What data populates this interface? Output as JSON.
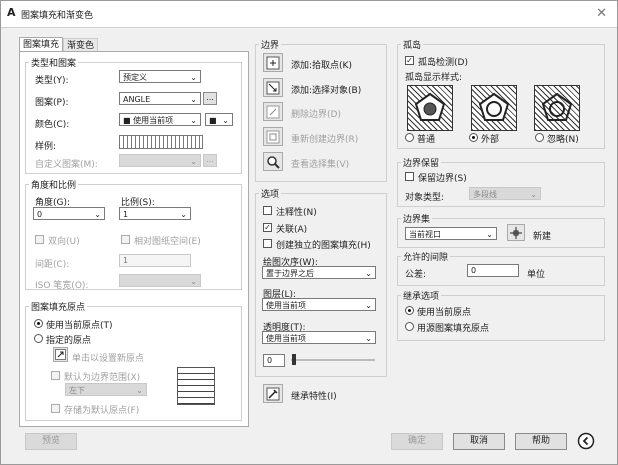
{
  "window": {
    "title": "图案填充和渐变色"
  },
  "tabs": [
    {
      "label": "图案填充"
    },
    {
      "label": "渐变色"
    }
  ],
  "type_pattern": {
    "group_title": "类型和图案",
    "type_label": "类型(Y):",
    "type_value": "预定义",
    "pattern_label": "图案(P):",
    "pattern_value": "ANGLE",
    "pattern_more": "...",
    "color_label": "颜色(C):",
    "color_value": "■ 使用当前项",
    "color_swatch_value": "■",
    "sample_label": "样例:",
    "custom_label": "自定义图案(M):",
    "custom_more": "..."
  },
  "angle_scale": {
    "group_title": "角度和比例",
    "angle_label": "角度(G):",
    "angle_value": "0",
    "scale_label": "比例(S):",
    "scale_value": "1",
    "double_label": "双向(U)",
    "paper_label": "相对图纸空间(E)",
    "spacing_label": "间距(C):",
    "spacing_value": "1",
    "iso_label": "ISO 笔宽(O):"
  },
  "origin": {
    "group_title": "图案填充原点",
    "use_current_label": "使用当前原点(T)",
    "specified_label": "指定的原点",
    "click_label": "单击以设置新原点",
    "default_extent_label": "默认为边界范围(X)",
    "position_value": "左下",
    "store_label": "存储为默认原点(F)"
  },
  "boundary": {
    "group_title": "边界",
    "items": [
      {
        "label": "添加:拾取点(K)"
      },
      {
        "label": "添加:选择对象(B)"
      },
      {
        "label": "删除边界(D)"
      },
      {
        "label": "重新创建边界(R)"
      },
      {
        "label": "查看选择集(V)"
      }
    ]
  },
  "options": {
    "group_title": "选项",
    "annotative_label": "注释性(N)",
    "associative_label": "关联(A)",
    "independent_label": "创建独立的图案填充(H)",
    "draw_order_label": "绘图次序(W):",
    "draw_order_value": "置于边界之后",
    "layer_label": "图层(L):",
    "layer_value": "使用当前项",
    "transparency_label": "透明度(T):",
    "transparency_value": "使用当前项",
    "transparency_amount": "0"
  },
  "inherit": {
    "label": "继承特性(I)"
  },
  "islands": {
    "group_title": "孤岛",
    "detect_label": "孤岛检测(D)",
    "style_label": "孤岛显示样式:",
    "normal_label": "普通",
    "outer_label": "外部",
    "ignore_label": "忽略(N)"
  },
  "boundary_retention": {
    "group_title": "边界保留",
    "retain_label": "保留边界(S)",
    "object_type_label": "对象类型:",
    "object_type_value": "多段线"
  },
  "boundary_set": {
    "group_title": "边界集",
    "value": "当前视口",
    "new_label": "新建"
  },
  "gap": {
    "group_title": "允许的间隙",
    "tolerance_label": "公差:",
    "tolerance_value": "0",
    "unit_label": "单位"
  },
  "inherit_options": {
    "group_title": "继承选项",
    "use_current_label": "使用当前原点",
    "use_source_label": "用源图案填充原点"
  },
  "footer": {
    "preview_label": "预览",
    "ok_label": "确定",
    "cancel_label": "取消",
    "help_label": "帮助"
  }
}
